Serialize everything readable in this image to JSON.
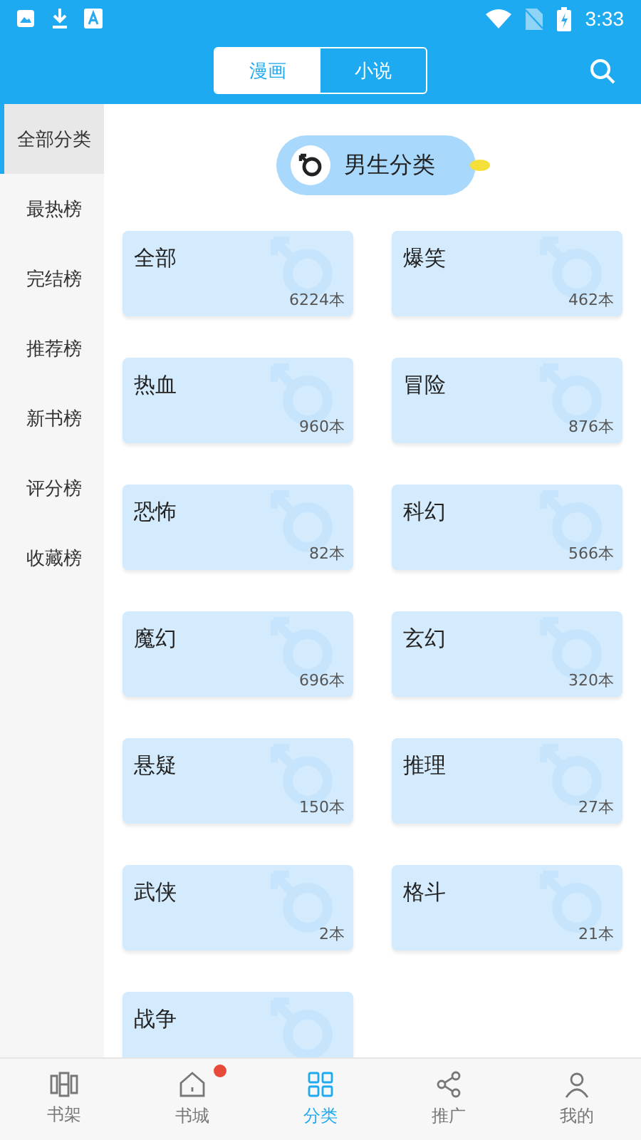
{
  "status_bar": {
    "time": "3:33"
  },
  "header": {
    "tabs": [
      {
        "label": "漫画",
        "selected": true
      },
      {
        "label": "小说",
        "selected": false
      }
    ]
  },
  "sidebar": {
    "items": [
      {
        "label": "全部分类",
        "selected": true
      },
      {
        "label": "最热榜",
        "selected": false
      },
      {
        "label": "完结榜",
        "selected": false
      },
      {
        "label": "推荐榜",
        "selected": false
      },
      {
        "label": "新书榜",
        "selected": false
      },
      {
        "label": "评分榜",
        "selected": false
      },
      {
        "label": "收藏榜",
        "selected": false
      }
    ]
  },
  "section": {
    "title": "男生分类"
  },
  "categories": [
    {
      "name": "全部",
      "count": "6224本"
    },
    {
      "name": "爆笑",
      "count": "462本"
    },
    {
      "name": "热血",
      "count": "960本"
    },
    {
      "name": "冒险",
      "count": "876本"
    },
    {
      "name": "恐怖",
      "count": "82本"
    },
    {
      "name": "科幻",
      "count": "566本"
    },
    {
      "name": "魔幻",
      "count": "696本"
    },
    {
      "name": "玄幻",
      "count": "320本"
    },
    {
      "name": "悬疑",
      "count": "150本"
    },
    {
      "name": "推理",
      "count": "27本"
    },
    {
      "name": "武侠",
      "count": "2本"
    },
    {
      "name": "格斗",
      "count": "21本"
    },
    {
      "name": "战争"
    }
  ],
  "bottom_nav": [
    {
      "label": "书架",
      "kind": "shelf",
      "selected": false,
      "badge": false
    },
    {
      "label": "书城",
      "kind": "home",
      "selected": false,
      "badge": true
    },
    {
      "label": "分类",
      "kind": "grid",
      "selected": true,
      "badge": false
    },
    {
      "label": "推广",
      "kind": "share",
      "selected": false,
      "badge": false
    },
    {
      "label": "我的",
      "kind": "user",
      "selected": false,
      "badge": false
    }
  ]
}
